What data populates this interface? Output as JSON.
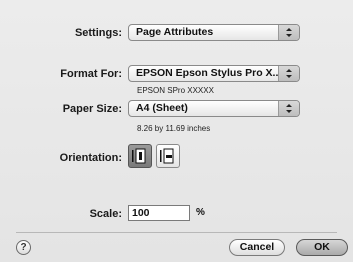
{
  "settings": {
    "label": "Settings:",
    "value": "Page Attributes"
  },
  "format_for": {
    "label": "Format For:",
    "value": "EPSON Epson Stylus Pro X...",
    "subtext": "EPSON SPro XXXXX"
  },
  "paper_size": {
    "label": "Paper Size:",
    "value": "A4 (Sheet)",
    "subtext": "8.26 by 11.69 inches"
  },
  "orientation": {
    "label": "Orientation:",
    "selected": "portrait",
    "options": [
      "portrait",
      "landscape"
    ]
  },
  "scale": {
    "label": "Scale:",
    "value": "100",
    "unit": "%"
  },
  "footer": {
    "help_label": "?",
    "cancel_label": "Cancel",
    "ok_label": "OK"
  }
}
